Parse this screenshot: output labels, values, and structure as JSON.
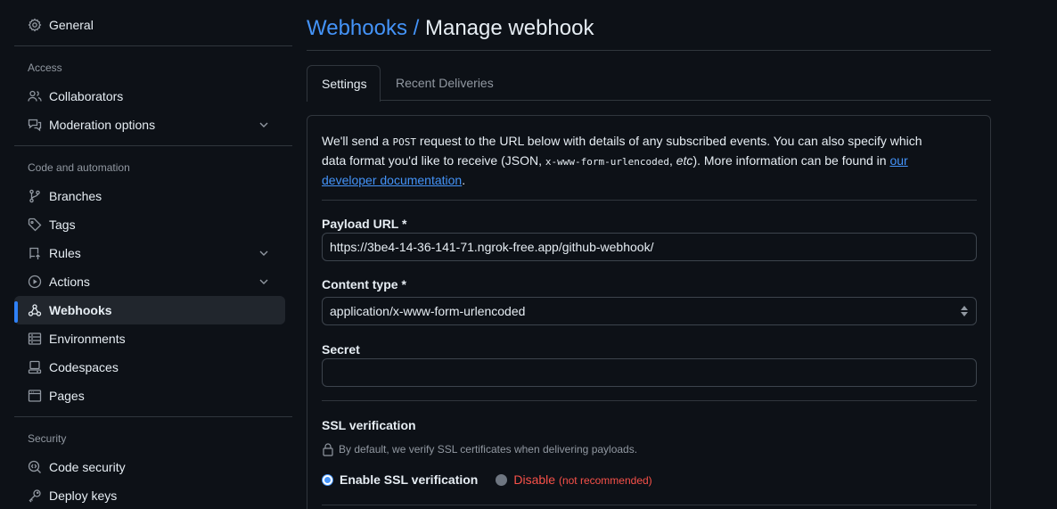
{
  "sidebar": {
    "general": "General",
    "access_title": "Access",
    "collaborators": "Collaborators",
    "moderation": "Moderation options",
    "code_automation_title": "Code and automation",
    "branches": "Branches",
    "tags": "Tags",
    "rules": "Rules",
    "actions": "Actions",
    "webhooks": "Webhooks",
    "environments": "Environments",
    "codespaces": "Codespaces",
    "pages": "Pages",
    "security_title": "Security",
    "code_security": "Code security",
    "deploy_keys": "Deploy keys"
  },
  "header": {
    "breadcrumb": "Webhooks",
    "separator": "/",
    "title": "Manage webhook"
  },
  "tabs": {
    "settings": "Settings",
    "recent": "Recent Deliveries"
  },
  "intro": {
    "part1": "We'll send a ",
    "post": "POST",
    "part2": " request to the URL below with details of any subscribed events. You can also specify which data format you'd like to receive (JSON, ",
    "encoded": "x-www-form-urlencoded",
    "part3": ", ",
    "etc": "etc",
    "part4": "). More information can be found in ",
    "link": "our developer documentation",
    "part5": "."
  },
  "form": {
    "payload_label": "Payload URL *",
    "payload_value": "https://3be4-14-36-141-71.ngrok-free.app/github-webhook/",
    "content_type_label": "Content type *",
    "content_type_value": "application/x-www-form-urlencoded",
    "secret_label": "Secret",
    "secret_value": "",
    "ssl_title": "SSL verification",
    "ssl_hint": "By default, we verify SSL certificates when delivering payloads.",
    "enable_label": "Enable SSL verification",
    "disable_label": "Disable",
    "disable_note": "(not recommended)"
  },
  "colors": {
    "background": "#0d1117",
    "accent": "#4493f8",
    "danger": "#f85149",
    "border": "#30363d"
  }
}
